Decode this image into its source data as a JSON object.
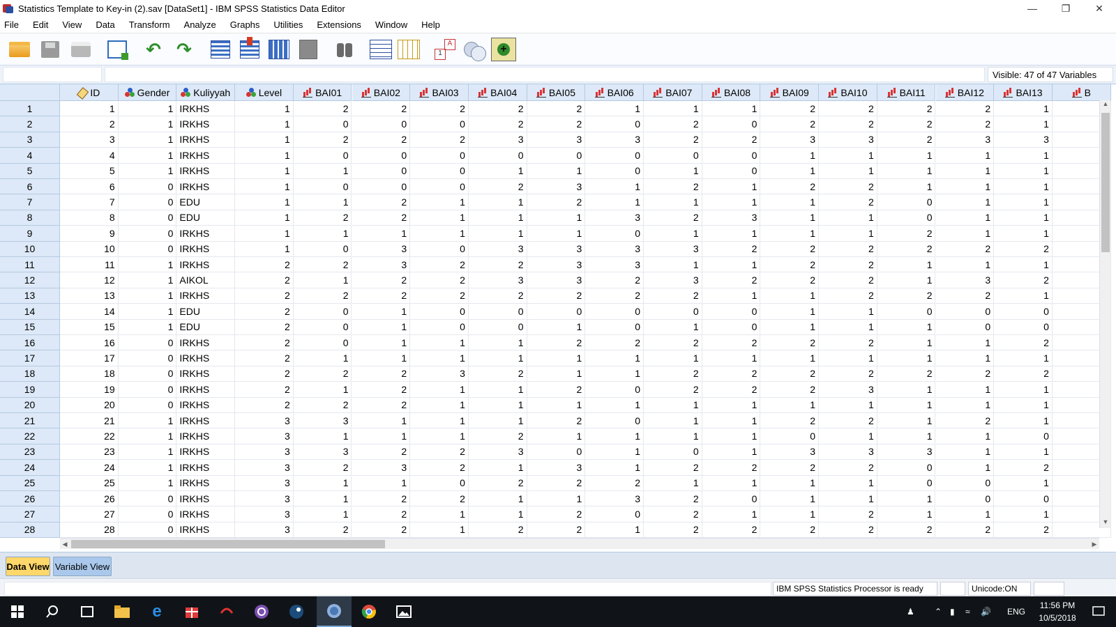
{
  "window": {
    "title": "Statistics Template to Key-in (2).sav [DataSet1] - IBM SPSS Statistics Data Editor",
    "minimize_icon": "minimize-icon",
    "maximize_icon": "restore-icon",
    "close_icon": "close-icon"
  },
  "menu": [
    "File",
    "Edit",
    "View",
    "Data",
    "Transform",
    "Analyze",
    "Graphs",
    "Utilities",
    "Extensions",
    "Window",
    "Help"
  ],
  "toolbar": [
    "open-data-icon",
    "save-icon",
    "print-icon",
    "recall-dialog-icon",
    "undo-icon",
    "redo-icon",
    "go-to-case-icon",
    "go-to-variable-icon",
    "variables-icon",
    "run-descriptives-icon",
    "find-icon",
    "insert-cases-icon",
    "insert-variable-icon",
    "split-file-icon",
    "weight-cases-icon",
    "extension-icon"
  ],
  "cell_editor": {
    "reference": "",
    "value": "",
    "visible_label": "Visible: 47 of 47 Variables"
  },
  "columns": [
    {
      "name": "ID",
      "icon": "scale"
    },
    {
      "name": "Gender",
      "icon": "nominal"
    },
    {
      "name": "Kuliyyah",
      "icon": "nominal"
    },
    {
      "name": "Level",
      "icon": "nominal"
    },
    {
      "name": "BAI01",
      "icon": "ordinal"
    },
    {
      "name": "BAI02",
      "icon": "ordinal"
    },
    {
      "name": "BAI03",
      "icon": "ordinal"
    },
    {
      "name": "BAI04",
      "icon": "ordinal"
    },
    {
      "name": "BAI05",
      "icon": "ordinal"
    },
    {
      "name": "BAI06",
      "icon": "ordinal"
    },
    {
      "name": "BAI07",
      "icon": "ordinal"
    },
    {
      "name": "BAI08",
      "icon": "ordinal"
    },
    {
      "name": "BAI09",
      "icon": "ordinal"
    },
    {
      "name": "BAI10",
      "icon": "ordinal"
    },
    {
      "name": "BAI11",
      "icon": "ordinal"
    },
    {
      "name": "BAI12",
      "icon": "ordinal"
    },
    {
      "name": "BAI13",
      "icon": "ordinal"
    },
    {
      "name": "B",
      "icon": "ordinal"
    }
  ],
  "rows": [
    [
      1,
      1,
      "IRKHS",
      1,
      2,
      2,
      2,
      2,
      2,
      1,
      1,
      1,
      2,
      2,
      2,
      2,
      1
    ],
    [
      2,
      1,
      "IRKHS",
      1,
      0,
      0,
      0,
      2,
      2,
      0,
      2,
      0,
      2,
      2,
      2,
      2,
      1
    ],
    [
      3,
      1,
      "IRKHS",
      1,
      2,
      2,
      2,
      3,
      3,
      3,
      2,
      2,
      3,
      3,
      2,
      3,
      3
    ],
    [
      4,
      1,
      "IRKHS",
      1,
      0,
      0,
      0,
      0,
      0,
      0,
      0,
      0,
      1,
      1,
      1,
      1,
      1
    ],
    [
      5,
      1,
      "IRKHS",
      1,
      1,
      0,
      0,
      1,
      1,
      0,
      1,
      0,
      1,
      1,
      1,
      1,
      1
    ],
    [
      6,
      0,
      "IRKHS",
      1,
      0,
      0,
      0,
      2,
      3,
      1,
      2,
      1,
      2,
      2,
      1,
      1,
      1
    ],
    [
      7,
      0,
      "EDU",
      1,
      1,
      2,
      1,
      1,
      2,
      1,
      1,
      1,
      1,
      2,
      0,
      1,
      1
    ],
    [
      8,
      0,
      "EDU",
      1,
      2,
      2,
      1,
      1,
      1,
      3,
      2,
      3,
      1,
      1,
      0,
      1,
      1
    ],
    [
      9,
      0,
      "IRKHS",
      1,
      1,
      1,
      1,
      1,
      1,
      0,
      1,
      1,
      1,
      1,
      2,
      1,
      1
    ],
    [
      10,
      0,
      "IRKHS",
      1,
      0,
      3,
      0,
      3,
      3,
      3,
      3,
      2,
      2,
      2,
      2,
      2,
      2
    ],
    [
      11,
      1,
      "IRKHS",
      2,
      2,
      3,
      2,
      2,
      3,
      3,
      1,
      1,
      2,
      2,
      1,
      1,
      1
    ],
    [
      12,
      1,
      "AIKOL",
      2,
      1,
      2,
      2,
      3,
      3,
      2,
      3,
      2,
      2,
      2,
      1,
      3,
      2
    ],
    [
      13,
      1,
      "IRKHS",
      2,
      2,
      2,
      2,
      2,
      2,
      2,
      2,
      1,
      1,
      2,
      2,
      2,
      1
    ],
    [
      14,
      1,
      "EDU",
      2,
      0,
      1,
      0,
      0,
      0,
      0,
      0,
      0,
      1,
      1,
      0,
      0,
      0
    ],
    [
      15,
      1,
      "EDU",
      2,
      0,
      1,
      0,
      0,
      1,
      0,
      1,
      0,
      1,
      1,
      1,
      0,
      0
    ],
    [
      16,
      0,
      "IRKHS",
      2,
      0,
      1,
      1,
      1,
      2,
      2,
      2,
      2,
      2,
      2,
      1,
      1,
      2
    ],
    [
      17,
      0,
      "IRKHS",
      2,
      1,
      1,
      1,
      1,
      1,
      1,
      1,
      1,
      1,
      1,
      1,
      1,
      1
    ],
    [
      18,
      0,
      "IRKHS",
      2,
      2,
      2,
      3,
      2,
      1,
      1,
      2,
      2,
      2,
      2,
      2,
      2,
      2
    ],
    [
      19,
      0,
      "IRKHS",
      2,
      1,
      2,
      1,
      1,
      2,
      0,
      2,
      2,
      2,
      3,
      1,
      1,
      1
    ],
    [
      20,
      0,
      "IRKHS",
      2,
      2,
      2,
      1,
      1,
      1,
      1,
      1,
      1,
      1,
      1,
      1,
      1,
      1
    ],
    [
      21,
      1,
      "IRKHS",
      3,
      3,
      1,
      1,
      1,
      2,
      0,
      1,
      1,
      2,
      2,
      1,
      2,
      1
    ],
    [
      22,
      1,
      "IRKHS",
      3,
      1,
      1,
      1,
      2,
      1,
      1,
      1,
      1,
      0,
      1,
      1,
      1,
      0
    ],
    [
      23,
      1,
      "IRKHS",
      3,
      3,
      2,
      2,
      3,
      0,
      1,
      0,
      1,
      3,
      3,
      3,
      1,
      1
    ],
    [
      24,
      1,
      "IRKHS",
      3,
      2,
      3,
      2,
      1,
      3,
      1,
      2,
      2,
      2,
      2,
      0,
      1,
      2
    ],
    [
      25,
      1,
      "IRKHS",
      3,
      1,
      1,
      0,
      2,
      2,
      2,
      1,
      1,
      1,
      1,
      0,
      0,
      1
    ],
    [
      26,
      0,
      "IRKHS",
      3,
      1,
      2,
      2,
      1,
      1,
      3,
      2,
      0,
      1,
      1,
      1,
      0,
      0
    ],
    [
      27,
      0,
      "IRKHS",
      3,
      1,
      2,
      1,
      1,
      2,
      0,
      2,
      1,
      1,
      2,
      1,
      1,
      1
    ],
    [
      28,
      0,
      "IRKHS",
      3,
      2,
      2,
      1,
      2,
      2,
      1,
      2,
      2,
      2,
      2,
      2,
      2,
      2
    ]
  ],
  "tabs": {
    "data_view": "Data View",
    "variable_view": "Variable View"
  },
  "status": {
    "processor": "IBM SPSS Statistics Processor is ready",
    "unicode": "Unicode:ON"
  },
  "taskbar": {
    "apps": [
      "windows-start-icon",
      "search-icon",
      "task-view-icon",
      "file-explorer-icon",
      "edge-icon",
      "gift-app-icon",
      "red-app-icon",
      "tor-browser-icon",
      "steam-icon",
      "spss-icon",
      "chrome-icon",
      "photos-icon"
    ],
    "lang": "ENG",
    "time": "11:56 PM",
    "date": "10/5/2018"
  }
}
